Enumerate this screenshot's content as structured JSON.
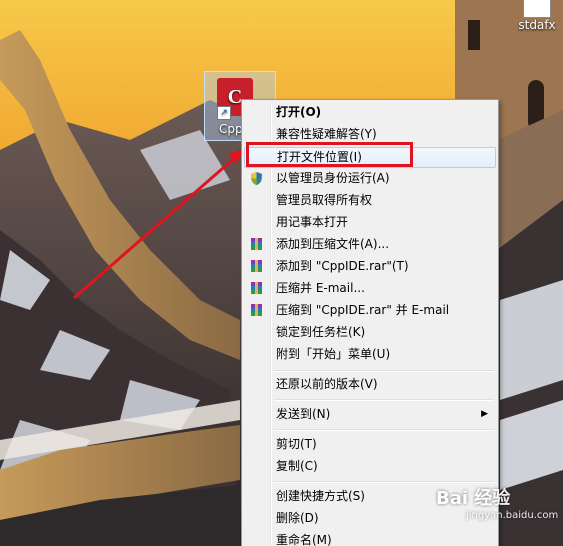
{
  "desktop": {
    "icons": [
      {
        "label": "stdafx"
      },
      {
        "label": "Cpp"
      }
    ]
  },
  "context_menu": {
    "items": [
      {
        "label": "打开(O)",
        "bold": true
      },
      {
        "label": "兼容性疑难解答(Y)"
      },
      {
        "label": "打开文件位置(I)",
        "highlighted": true
      },
      {
        "label": "以管理员身份运行(A)",
        "icon": "uac-shield-icon"
      },
      {
        "label": "管理员取得所有权"
      },
      {
        "label": "用记事本打开"
      },
      {
        "label": "添加到压缩文件(A)...",
        "icon": "winrar-icon"
      },
      {
        "label": "添加到 \"CppIDE.rar\"(T)",
        "icon": "winrar-icon"
      },
      {
        "label": "压缩并 E-mail...",
        "icon": "winrar-icon"
      },
      {
        "label": "压缩到 \"CppIDE.rar\" 并 E-mail",
        "icon": "winrar-icon"
      },
      {
        "label": "锁定到任务栏(K)"
      },
      {
        "label": "附到「开始」菜单(U)"
      },
      {
        "label": "还原以前的版本(V)"
      },
      {
        "label": "发送到(N)",
        "submenu": true
      },
      {
        "label": "剪切(T)"
      },
      {
        "label": "复制(C)"
      },
      {
        "label": "创建快捷方式(S)"
      },
      {
        "label": "删除(D)"
      },
      {
        "label": "重命名(M)"
      }
    ]
  },
  "watermark": {
    "text": "Bai 经验",
    "sub": "jingyan.baidu.com"
  },
  "colors": {
    "highlight_box": "#e0141e",
    "arrow": "#e0141e"
  }
}
